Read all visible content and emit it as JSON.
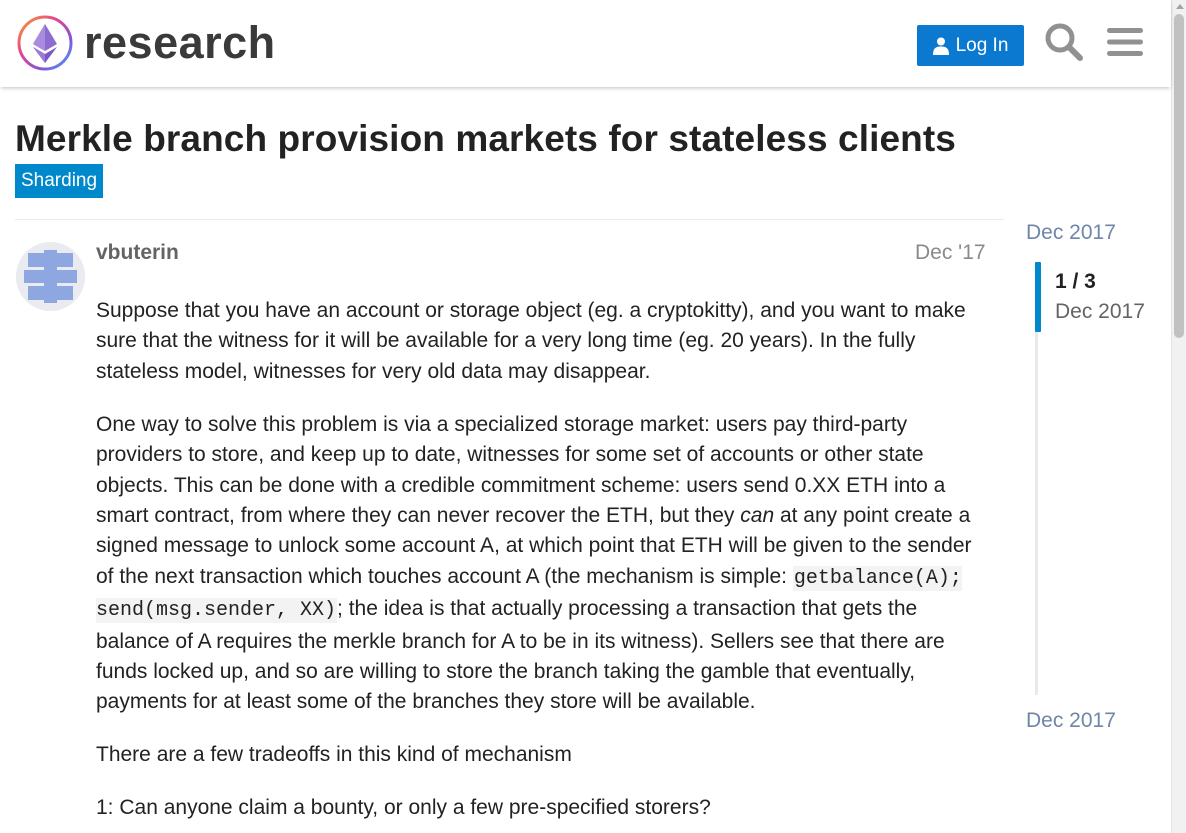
{
  "header": {
    "brand": "research",
    "login_label": "Log In"
  },
  "topic": {
    "title": "Merkle branch provision markets for stateless clients",
    "category": "Sharding"
  },
  "post": {
    "username": "vbuterin",
    "date": "Dec '17",
    "p1": "Suppose that you have an account or storage object (eg. a cryptokitty), and you want to make sure that the witness for it will be available for a very long time (eg. 20 years). In the fully stateless model, witnesses for very old data may disappear.",
    "p2_a": "One way to solve this problem is via a specialized storage market: users pay third-party providers to store, and keep up to date, witnesses for some set of accounts or other state objects. This can be done with a credible commitment scheme: users send 0.XX ETH into a smart contract, from where they can never recover the ETH, but they ",
    "p2_em": "can",
    "p2_b": " at any point create a signed message to unlock some account A, at which point that ETH will be given to the sender of the next transaction which touches account A (the mechanism is simple: ",
    "p2_code": "getbalance(A); send(msg.sender, XX)",
    "p2_c": "; the idea is that actually processing a transaction that gets the balance of A requires the merkle branch for A to be in its witness). Sellers see that there are funds locked up, and so are willing to store the branch taking the gamble that eventually, payments for at least some of the branches they store will be available.",
    "p3": "There are a few tradeoffs in this kind of mechanism",
    "p4": "1: Can anyone claim a bounty, or only a few pre-specified storers?"
  },
  "timeline": {
    "start_date": "Dec 2017",
    "position": "1 / 3",
    "current_date": "Dec 2017",
    "end_date": "Dec 2017",
    "progress_fraction": 0.33
  },
  "colors": {
    "accent": "#0b79d0",
    "category": "#0088cc",
    "timeline_link": "#6e86a8"
  },
  "icons": {
    "logo": "ethereum-research-logo",
    "login": "user-icon",
    "search": "search-icon",
    "menu": "hamburger-menu-icon",
    "avatar": "letter-avatar-icon"
  }
}
